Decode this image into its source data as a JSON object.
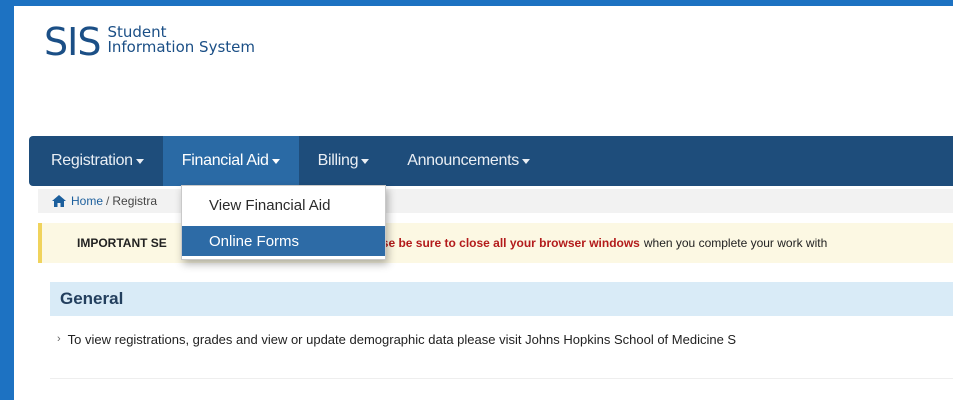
{
  "logo": {
    "mark": "SIS",
    "line1": "Student",
    "line2": "Information System"
  },
  "nav": {
    "items": [
      {
        "label": "Registration"
      },
      {
        "label": "Financial Aid"
      },
      {
        "label": "Billing"
      },
      {
        "label": "Announcements"
      }
    ],
    "active_index": 1
  },
  "breadcrumb": {
    "home": "Home",
    "separator": "/",
    "current": "Registra"
  },
  "alert": {
    "bold_prefix": "IMPORTANT SE",
    "red_text": "se be sure to close all your browser windows",
    "rest": "when you complete your work with"
  },
  "general": {
    "title": "General",
    "bullet": "›",
    "text": "To view registrations, grades and view or update demographic data please visit Johns Hopkins School of Medicine S"
  },
  "dropdown": {
    "items": [
      {
        "label": "View Financial Aid"
      },
      {
        "label": "Online Forms",
        "highlighted": true
      }
    ]
  },
  "colors": {
    "frame": "#1d72c2",
    "navbar": "#1e4d7b",
    "nav_active": "#2a6aa5",
    "alert_bg": "#fcf8e3",
    "alert_red": "#b31b1b",
    "section_bg": "#d9ebf7",
    "dropdown_highlight": "#2d6ba6"
  },
  "icons": {
    "home": "home-icon",
    "caret": "caret-down-icon"
  }
}
